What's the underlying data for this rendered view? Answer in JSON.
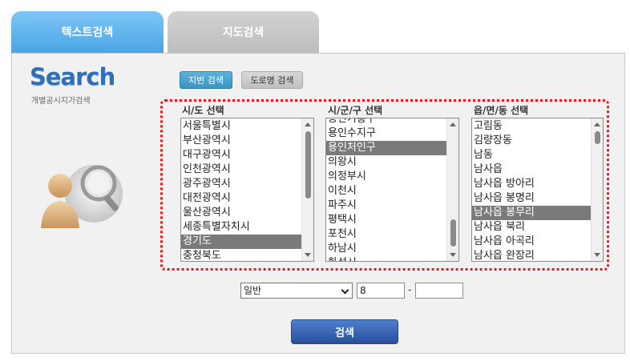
{
  "tabs": [
    {
      "label": "텍스트검색",
      "active": true
    },
    {
      "label": "지도검색",
      "active": false
    }
  ],
  "logo": {
    "title": "Search",
    "subtitle": "개별공시지가검색"
  },
  "mode_buttons": {
    "jibun": "지번 검색",
    "road": "도로명 검색"
  },
  "columns": {
    "sido": {
      "label": "시/도 선택",
      "items": [
        "서울특별시",
        "부산광역시",
        "대구광역시",
        "인천광역시",
        "광주광역시",
        "대전광역시",
        "울산광역시",
        "세종특별자치시",
        "경기도",
        "충청북도"
      ],
      "selected_index": 8
    },
    "sigungu": {
      "label": "시/군/구 선택",
      "items": [
        "용인기흥구",
        "용인수지구",
        "용인처인구",
        "의왕시",
        "의정부시",
        "이천시",
        "파주시",
        "평택시",
        "포천시",
        "하남시",
        "화성시"
      ],
      "selected_index": 2
    },
    "eupmyeondong": {
      "label": "읍/면/동 선택",
      "items": [
        "고림동",
        "김량장동",
        "남동",
        "남사읍",
        "남사읍 방아리",
        "남사읍 봉명리",
        "남사읍 봉무리",
        "남사읍 북리",
        "남사읍 아곡리",
        "남사읍 완장리"
      ],
      "selected_index": 6
    }
  },
  "form": {
    "land_type": "일반",
    "bonbun": "8",
    "bubun": "",
    "separator": "-"
  },
  "search_button": "검색",
  "colors": {
    "accent": "#4aa5e6",
    "frame": "#e31b1b",
    "button": "#284f9a"
  }
}
